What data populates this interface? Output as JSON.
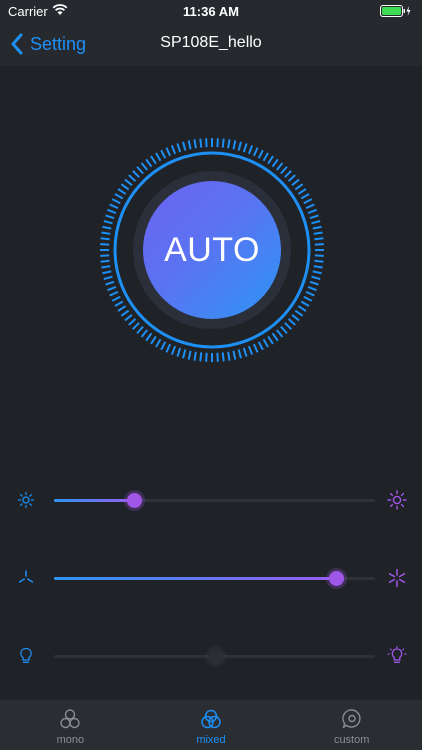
{
  "status_bar": {
    "carrier": "Carrier",
    "time": "11:36 AM"
  },
  "nav": {
    "back_label": "Setting",
    "title": "SP108E_hello"
  },
  "main": {
    "mode_button_label": "AUTO"
  },
  "sliders": [
    {
      "name": "brightness",
      "value_fraction": 0.25,
      "enabled": true
    },
    {
      "name": "speed",
      "value_fraction": 0.88,
      "enabled": true
    },
    {
      "name": "white-light",
      "value_fraction": 0.5,
      "enabled": false
    }
  ],
  "tabs": [
    {
      "label": "mono",
      "icon": "three-circles-icon",
      "active": false
    },
    {
      "label": "mixed",
      "icon": "overlapping-circles-icon",
      "active": true
    },
    {
      "label": "custom",
      "icon": "chat-bubble-icon",
      "active": false
    }
  ],
  "colors": {
    "accent_blue": "#1e90f5",
    "accent_purple": "#a057e8",
    "background": "#1f2227"
  }
}
